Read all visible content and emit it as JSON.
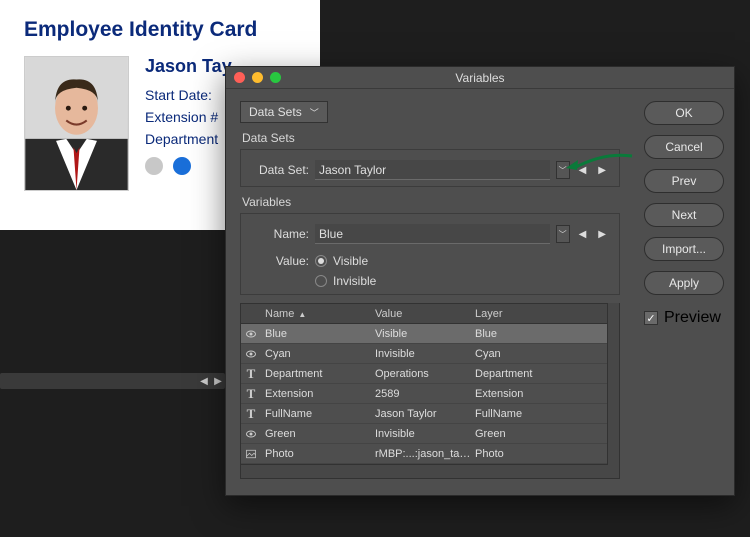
{
  "card": {
    "title": "Employee Identity Card",
    "name": "Jason Tay",
    "fields": {
      "start": "Start Date:",
      "ext": "Extension #",
      "dept": "Department"
    }
  },
  "dialog": {
    "title": "Variables",
    "topDropdown": "Data Sets",
    "section1": "Data Sets",
    "datasetLabel": "Data Set:",
    "datasetValue": "Jason Taylor",
    "section2": "Variables",
    "nameLabel": "Name:",
    "nameValue": "Blue",
    "valueLabel": "Value:",
    "radioVisible": "Visible",
    "radioInvisible": "Invisible",
    "table": {
      "headers": {
        "name": "Name",
        "value": "Value",
        "layer": "Layer"
      },
      "rows": [
        {
          "icon": "eye",
          "name": "Blue",
          "value": "Visible",
          "layer": "Blue",
          "selected": true
        },
        {
          "icon": "eye",
          "name": "Cyan",
          "value": "Invisible",
          "layer": "Cyan"
        },
        {
          "icon": "text",
          "name": "Department",
          "value": "Operations",
          "layer": "Department"
        },
        {
          "icon": "text",
          "name": "Extension",
          "value": "2589",
          "layer": "Extension"
        },
        {
          "icon": "text",
          "name": "FullName",
          "value": "Jason Taylor",
          "layer": "FullName"
        },
        {
          "icon": "eye",
          "name": "Green",
          "value": "Invisible",
          "layer": "Green"
        },
        {
          "icon": "image",
          "name": "Photo",
          "value": "rMBP:...:jason_taylor.jpg",
          "layer": "Photo"
        }
      ]
    }
  },
  "buttons": {
    "ok": "OK",
    "cancel": "Cancel",
    "prev": "Prev",
    "next": "Next",
    "import": "Import...",
    "apply": "Apply",
    "preview": "Preview"
  }
}
